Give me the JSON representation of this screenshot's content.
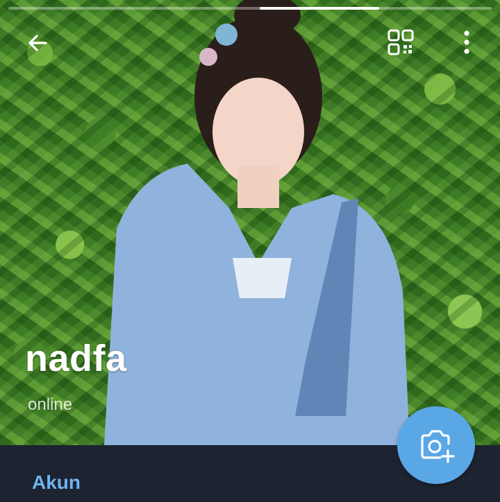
{
  "profile": {
    "name": "nadfa",
    "status": "online"
  },
  "story_progress": {
    "segments": 1,
    "active_fraction": 0.25
  },
  "toolbar": {
    "back_icon": "arrow-left-icon",
    "qr_icon": "qr-code-icon",
    "more_icon": "more-vertical-icon"
  },
  "section": {
    "title": "Akun"
  },
  "fab": {
    "icon": "camera-add-icon",
    "color": "#5aa7e6"
  },
  "colors": {
    "panel": "#1d2330",
    "accent": "#6fb4f0"
  }
}
